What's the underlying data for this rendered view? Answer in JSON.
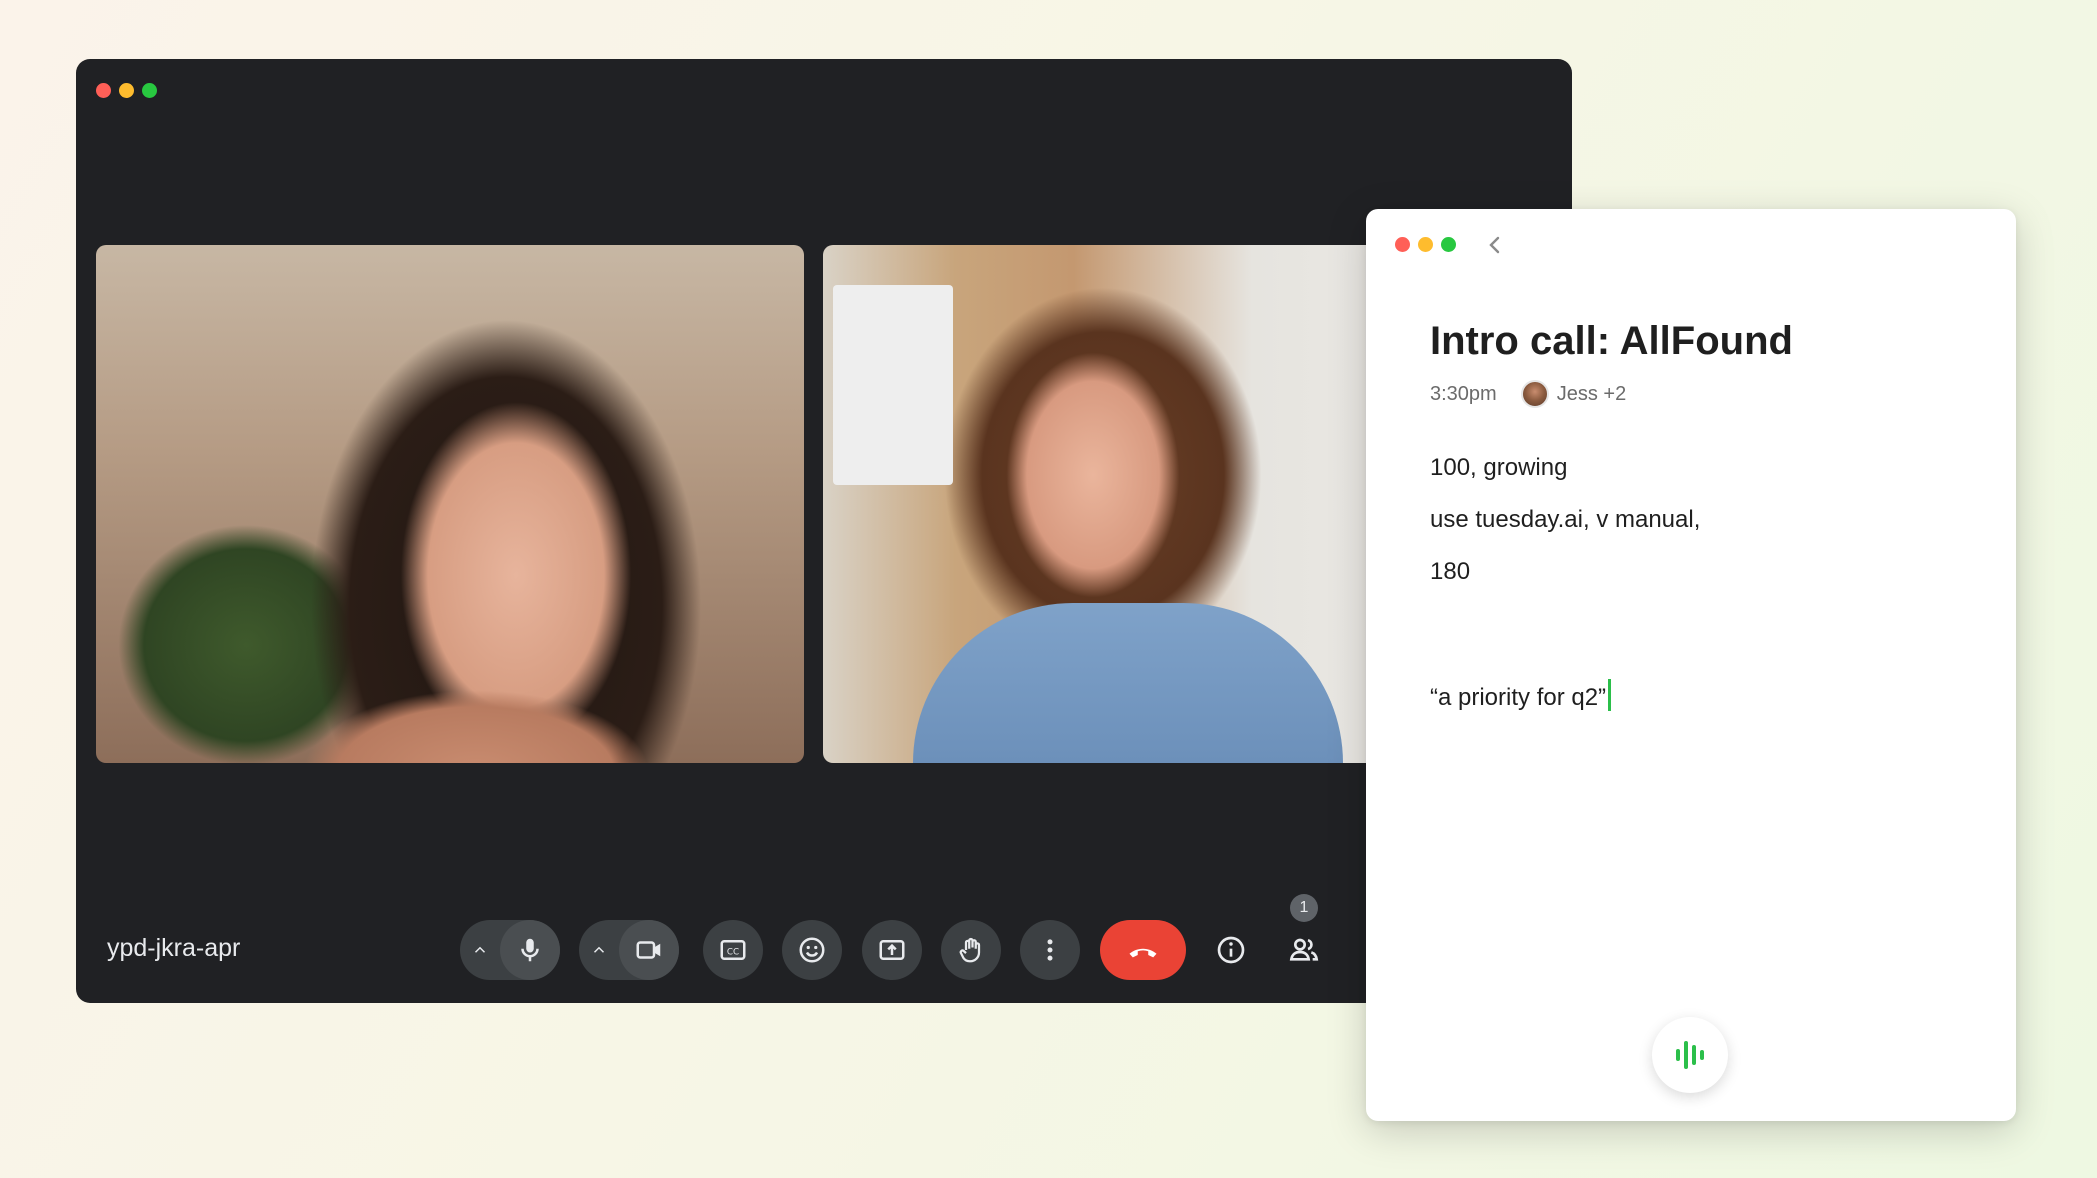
{
  "meet": {
    "meeting_code": "ypd-jkra-apr",
    "participants_badge": "1",
    "icons": [
      "mic-icon",
      "camera-icon",
      "captions-icon",
      "emoji-icon",
      "present-icon",
      "raise-hand-icon",
      "more-icon",
      "end-call-icon",
      "info-icon",
      "people-icon"
    ]
  },
  "notes": {
    "title": "Intro call: AllFound",
    "time": "3:30pm",
    "attendees": "Jess +2",
    "lines": [
      "100, growing",
      "use tuesday.ai, v manual,",
      "180",
      "“a priority for q2”"
    ]
  },
  "colors": {
    "meet_bg": "#202124",
    "end_call": "#ea4335",
    "accent_green": "#2bbf4a"
  }
}
